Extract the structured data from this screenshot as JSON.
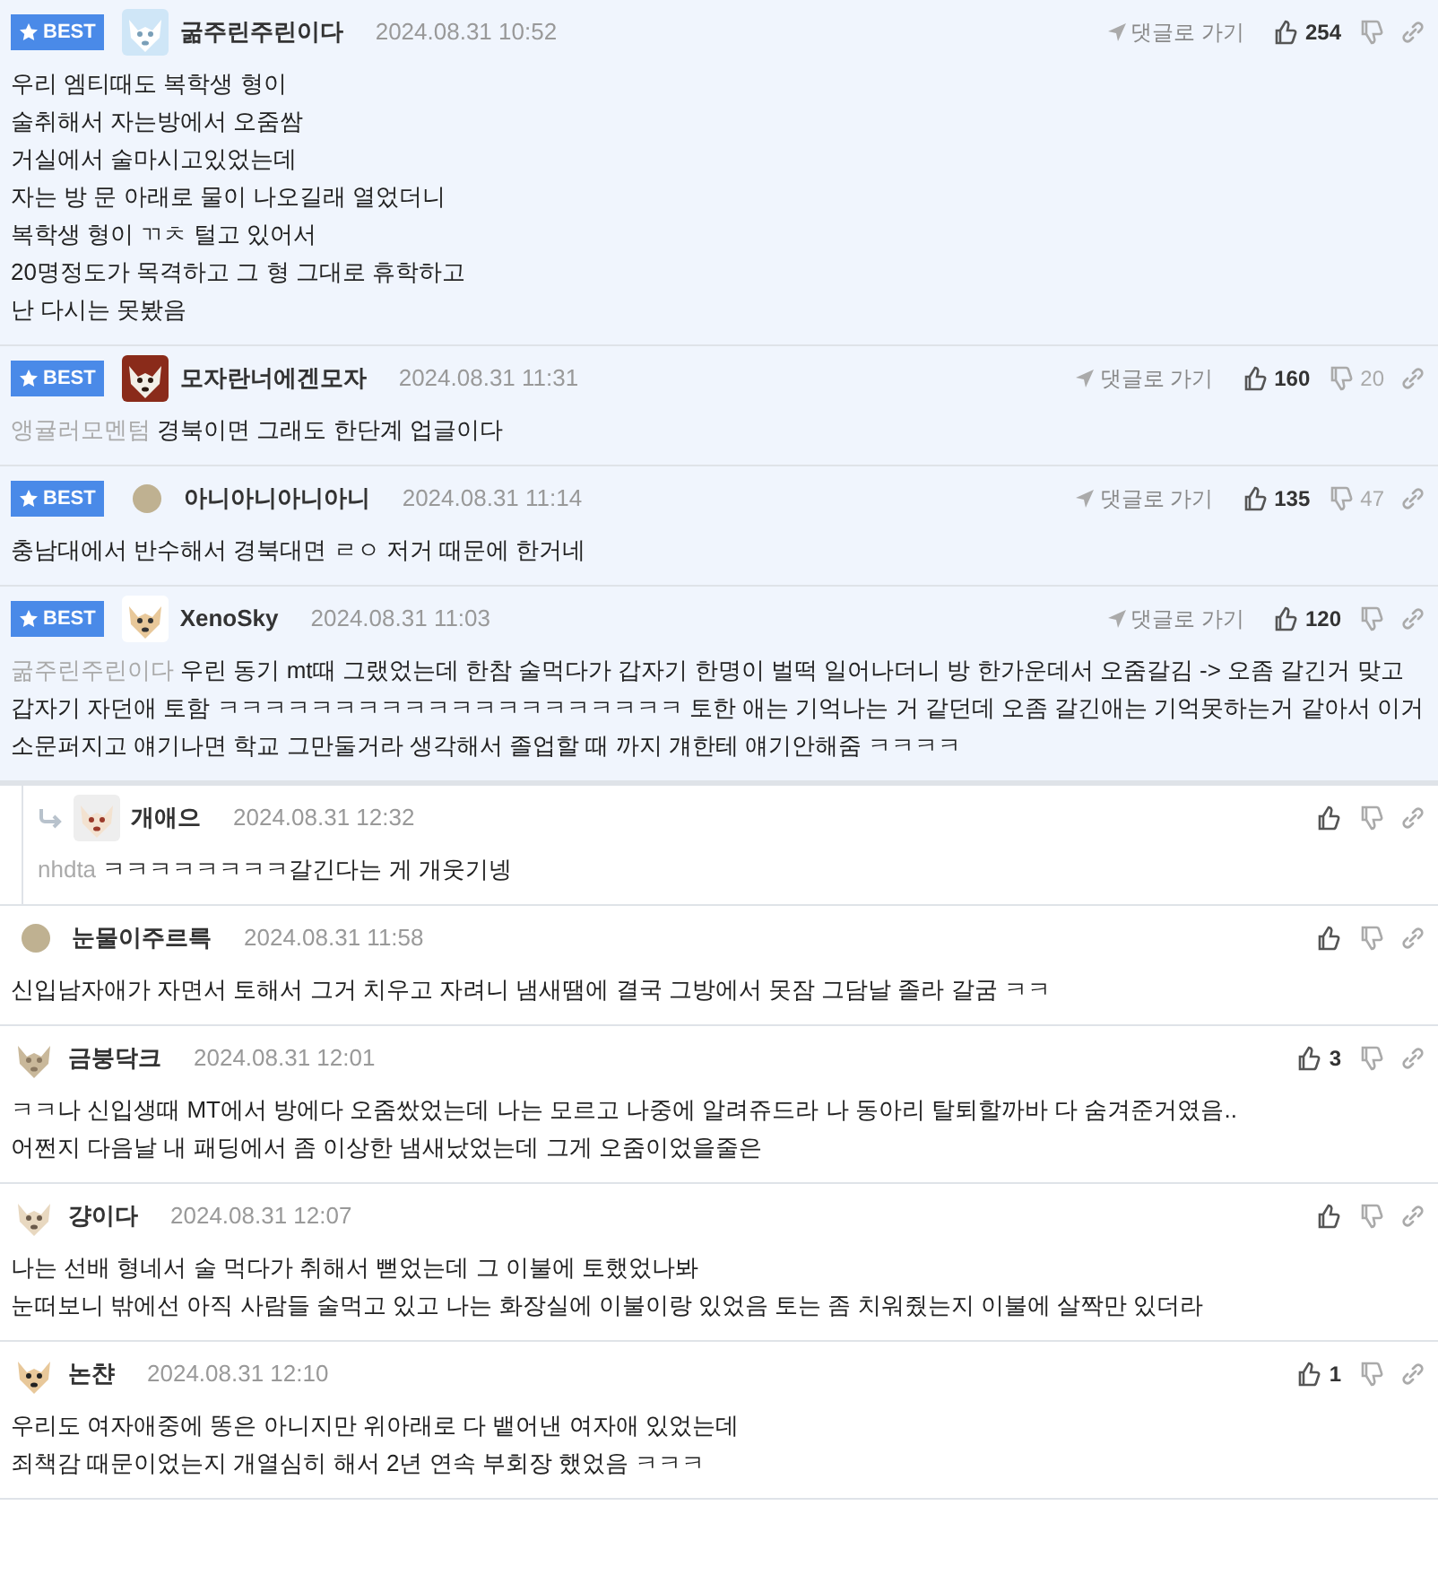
{
  "comments": [
    {
      "best": true,
      "badge": "BEST",
      "reply": false,
      "avatar": {
        "kind": "picture"
      },
      "author": "굶주린주린이다",
      "date": "2024.08.31 10:52",
      "goto": "댓글로 가기",
      "likes": "254",
      "lines": [
        "우리 엠티때도 복학생 형이",
        "술취해서 자는방에서 오줌쌈",
        "거실에서 술마시고있었는데",
        "자는 방 문 아래로 물이 나오길래 열었더니",
        "복학생 형이 ㄲㅊ 털고 있어서",
        "20명정도가 목격하고 그 형 그대로 휴학하고",
        "난 다시는 못봤음"
      ]
    },
    {
      "best": true,
      "badge": "BEST",
      "reply": false,
      "avatar": {
        "kind": "picture"
      },
      "author": "모자란너에겐모자",
      "date": "2024.08.31 11:31",
      "goto": "댓글로 가기",
      "likes": "160",
      "dislikes": "20",
      "mention": "앵귤러모멘텀",
      "lines": [
        "경북이면 그래도 한단계 업글이다"
      ]
    },
    {
      "best": true,
      "badge": "BEST",
      "reply": false,
      "avatar": {
        "kind": "dot"
      },
      "author": "아니아니아니아니",
      "date": "2024.08.31 11:14",
      "goto": "댓글로 가기",
      "likes": "135",
      "dislikes": "47",
      "lines": [
        "충남대에서 반수해서 경북대면 ㄹㅇ 저거 때문에 한거네"
      ]
    },
    {
      "best": true,
      "badge": "BEST",
      "reply": false,
      "avatar": {
        "kind": "picture"
      },
      "author": "XenoSky",
      "date": "2024.08.31 11:03",
      "goto": "댓글로 가기",
      "likes": "120",
      "mention": "굶주린주린이다",
      "lines": [
        "우린 동기 mt때 그랬었는데 한참 술먹다가 갑자기 한명이 벌떡 일어나더니 방 한가운데서 오줌갈김 -> 오좀 갈긴거 맞고 갑자기 자던애 토함 ㅋㅋㅋㅋㅋㅋㅋㅋㅋㅋㅋㅋㅋㅋㅋㅋㅋㅋㅋㅋ 토한 애는 기억나는 거 같던데 오좀 갈긴애는 기억못하는거 같아서 이거 소문퍼지고 얘기나면 학교 그만둘거라 생각해서 졸업할 때 까지 걔한테 얘기안해줌 ㅋㅋㅋㅋ"
      ]
    },
    {
      "best": false,
      "reply": true,
      "avatar": {
        "kind": "picture"
      },
      "author": "개애으",
      "date": "2024.08.31 12:32",
      "mention": "nhdta",
      "lines": [
        "ㅋㅋㅋㅋㅋㅋㅋㅋ갈긴다는 게 개웃기넹"
      ]
    },
    {
      "best": false,
      "reply": false,
      "avatar": {
        "kind": "dot"
      },
      "author": "눈물이주르륵",
      "date": "2024.08.31 11:58",
      "lines": [
        "신입남자애가 자면서 토해서 그거 치우고 자려니 냄새땜에 결국 그방에서 못잠 그담날 졸라 갈굼 ㅋㅋ"
      ]
    },
    {
      "best": false,
      "reply": false,
      "avatar": {
        "kind": "picture"
      },
      "author": "금붕닥크",
      "date": "2024.08.31 12:01",
      "likes": "3",
      "lines": [
        "ㅋㅋ나 신입생때 MT에서 방에다 오줌쌌었는데 나는 모르고 나중에 알려쥬드라 나 동아리 탈퇴할까바 다 숨겨준거였음..",
        "어쩐지 다음날 내 패딩에서 좀 이상한 냄새났었는데 그게 오줌이었을줄은"
      ]
    },
    {
      "best": false,
      "reply": false,
      "avatar": {
        "kind": "picture"
      },
      "author": "걍이다",
      "date": "2024.08.31 12:07",
      "lines": [
        "나는 선배 형네서 술 먹다가 취해서 뻗었는데 그 이불에 토했었나봐",
        "눈떠보니 밖에선 아직 사람들 술먹고 있고 나는 화장실에 이불이랑 있었음 토는 좀 치워줬는지 이불에 살짝만 있더라"
      ]
    },
    {
      "best": false,
      "reply": false,
      "avatar": {
        "kind": "picture"
      },
      "author": "논챤",
      "date": "2024.08.31 12:10",
      "likes": "1",
      "lines": [
        "우리도 여자애중에 똥은 아니지만 위아래로 다 뱉어낸 여자애 있었는데",
        "죄책감 때문이었는지 개열심히 해서 2년 연속 부회장 했었음 ㅋㅋㅋ"
      ]
    }
  ]
}
